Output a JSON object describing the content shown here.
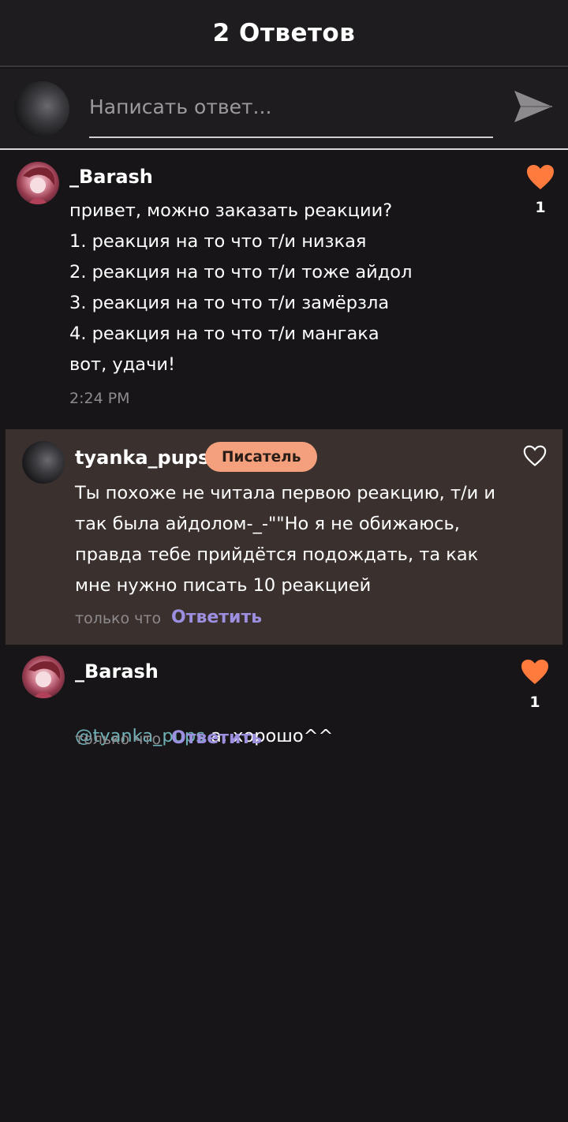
{
  "header": {
    "title": "2 Ответов"
  },
  "reply_bar": {
    "placeholder": "Написать ответ..."
  },
  "comments": [
    {
      "username": "_Barash",
      "text": "привет, можно заказать реакции?\n1. реакция на то что т/и низкая\n2. реакция на то что т/и тоже айдол\n3. реакция на то что т/и замёрзла\n4. реакция на то что т/и мангака\nвот, удачи!",
      "time": "2:24 PM",
      "likes": "1",
      "liked": true
    },
    {
      "username": "tyanka_pups",
      "badge": "Писатель",
      "text": "Ты похоже не читала первою реакцию, т/и и\nтак была айдолом-_-\"\"Но я не обижаюсь,\nправда тебе прийдётся подождать, та как\nмне нужно писать 10 реакцией",
      "time": "только что",
      "reply_label": "Ответить",
      "liked": false
    },
    {
      "username": "_Barash",
      "mention": "@tyanka_pups",
      "text": " а, хорошо^^",
      "time": "только что",
      "reply_label": "Ответить",
      "likes": "1",
      "liked": true
    }
  ],
  "colors": {
    "background": "#171518",
    "like_active": "#ff7a3d",
    "reply_link": "#9d8fe0",
    "badge": "#f4a07c",
    "mention": "#6fb3b8",
    "highlight": "#3a302e"
  }
}
